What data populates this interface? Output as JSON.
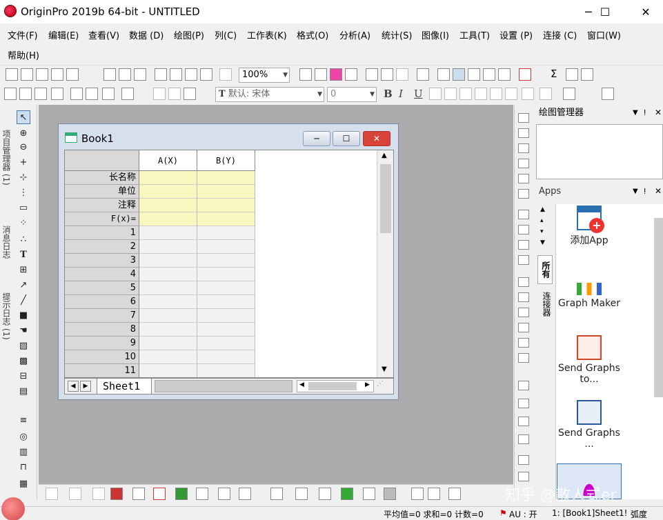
{
  "window": {
    "title": "OriginPro 2019b 64-bit - UNTITLED",
    "minimize_glyph": "─",
    "maximize_glyph": "☐",
    "close_glyph": "✕"
  },
  "menubar": {
    "items": [
      "文件(F)",
      "编辑(E)",
      "查看(V)",
      "数据 (D)",
      "绘图(P)",
      "列(C)",
      "工作表(K)",
      "格式(O)",
      "分析(A)",
      "统计(S)",
      "图像(I)",
      "工具(T)",
      "设置 (P)",
      "连接 (C)",
      "窗口(W)"
    ],
    "help": "帮助(H)"
  },
  "toolbar": {
    "zoom_value": "100%",
    "font_name": "默认: 宋体",
    "font_size": "0",
    "bold": "B",
    "italic": "I",
    "underline": "U",
    "sum_label": "Σ"
  },
  "left_panel": {
    "tabs": [
      "项目管理器 (1)",
      "消息日志",
      "提示日志 (1)"
    ]
  },
  "book": {
    "title": "Book1",
    "columns": [
      "A(X)",
      "B(Y)"
    ],
    "meta_rows": [
      "长名称",
      "单位",
      "注释",
      "F(x)="
    ],
    "data_rows": [
      "1",
      "2",
      "3",
      "4",
      "5",
      "6",
      "7",
      "8",
      "9",
      "10",
      "11"
    ],
    "sheet_tab": "Sheet1"
  },
  "graph_manager": {
    "title": "绘图管理器"
  },
  "apps_panel": {
    "title": "Apps",
    "side_tabs": [
      "所有",
      "连接器"
    ],
    "items": [
      {
        "label": "添加App",
        "icon": "add-app-icon"
      },
      {
        "label": "Graph Maker",
        "icon": "graph-maker-icon"
      },
      {
        "label": "Send Graphs to...",
        "icon": "send-graphs-ppt-icon"
      },
      {
        "label": "Send Graphs ...",
        "icon": "send-graphs-word-icon"
      }
    ]
  },
  "statusbar": {
    "stats": "平均值=0 求和=0 计数=0",
    "au": "AU : 开",
    "location": "1: [Book1]Sheet1!",
    "angle": "弧度"
  },
  "watermark": "知乎 @散人式er",
  "colors": {
    "workspace_bg": "#ababab",
    "meta_row_bg": "#f7f7c0",
    "close_button": "#d9443a"
  }
}
